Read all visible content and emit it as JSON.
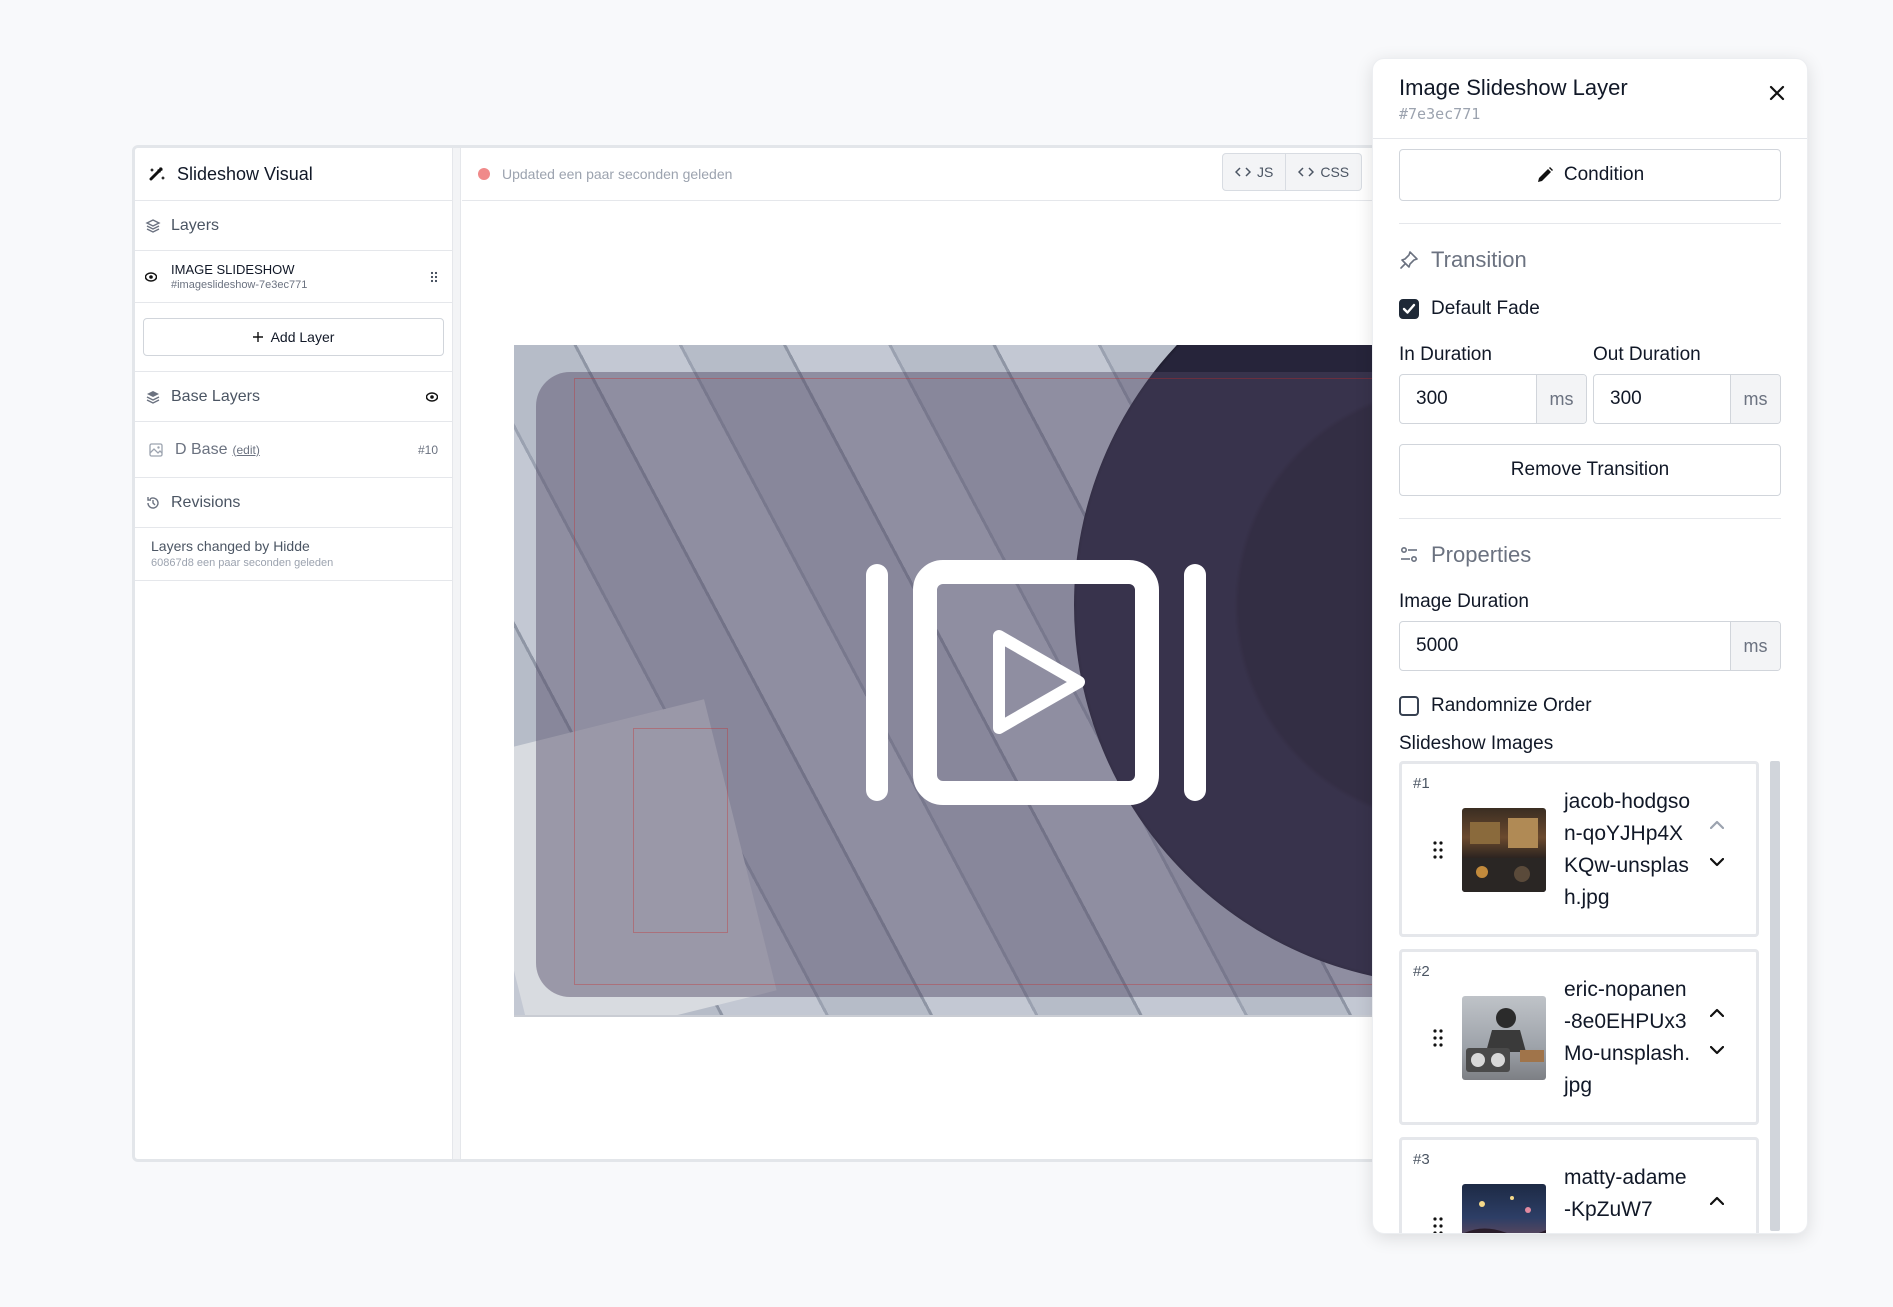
{
  "sidebar": {
    "app_title": "Slideshow Visual",
    "layers_label": "Layers",
    "layer": {
      "title": "IMAGE SLIDESHOW",
      "subtitle": "#imageslideshow-7e3ec771"
    },
    "add_layer_label": "Add Layer",
    "base_layers_label": "Base Layers",
    "base": {
      "name": "D Base",
      "edit_label": "(edit)",
      "id": "#10"
    },
    "revisions_label": "Revisions",
    "revision": {
      "title": "Layers changed by Hidde",
      "subtitle": "60867d8 een paar seconden geleden"
    }
  },
  "topbar": {
    "status_text": "Updated een paar seconden geleden",
    "status_color": "#f08a8a",
    "js_label": "JS",
    "css_label": "CSS"
  },
  "panel": {
    "title": "Image Slideshow Layer",
    "id": "#7e3ec771",
    "condition_label": "Condition",
    "transition_title": "Transition",
    "default_fade_label": "Default Fade",
    "default_fade_checked": true,
    "in_duration_label": "In Duration",
    "in_duration_value": "300",
    "out_duration_label": "Out Duration",
    "out_duration_value": "300",
    "unit": "ms",
    "remove_transition_label": "Remove Transition",
    "properties_title": "Properties",
    "image_duration_label": "Image Duration",
    "image_duration_value": "5000",
    "randomize_label": "Randomnize Order",
    "randomize_checked": false,
    "slideshow_images_label": "Slideshow Images",
    "images": [
      {
        "num": "#1",
        "filename": "jacob-hodgson-qoYJHp4XKQw-unsplash.jpg"
      },
      {
        "num": "#2",
        "filename": "eric-nopanen-8e0EHPUx3Mo-unsplash.jpg"
      },
      {
        "num": "#3",
        "filename": "matty-adame-KpZuW7"
      }
    ]
  },
  "icons": {
    "logo": "slideshow-tools-icon",
    "layers": "layers-icon",
    "eye": "eye-icon",
    "drag": "drag-handle-icon",
    "plus": "plus-icon",
    "image": "image-icon",
    "history": "history-icon",
    "code": "code-icon",
    "close": "close-icon",
    "pencil": "pencil-icon",
    "transition": "pin-icon",
    "properties": "sliders-icon",
    "chevron_up": "chevron-up-icon",
    "chevron_down": "chevron-down-icon",
    "slideshow": "slideshow-play-icon"
  }
}
